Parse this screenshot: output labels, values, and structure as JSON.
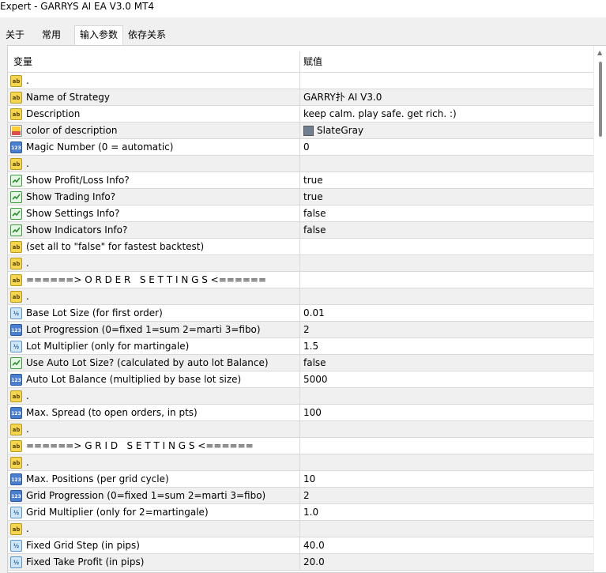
{
  "window": {
    "title": "Expert - GARRYS AI EA V3.0 MT4"
  },
  "tabs": [
    {
      "label": "关于"
    },
    {
      "label": "常用"
    },
    {
      "label": "输入参数"
    },
    {
      "label": "依存关系"
    }
  ],
  "table": {
    "headers": {
      "name": "变量",
      "value": "赋值"
    },
    "rows": [
      {
        "icon": "ab",
        "name": ".",
        "value": ""
      },
      {
        "icon": "ab",
        "name": "Name of Strategy",
        "value": "GARRY扑 AI V3.0"
      },
      {
        "icon": "ab",
        "name": "Description",
        "value": "keep calm. play safe. get rich. :)"
      },
      {
        "icon": "color",
        "name": "color of description",
        "value": "SlateGray",
        "swatch": "#708090"
      },
      {
        "icon": "123",
        "name": "Magic Number (0 = automatic)",
        "value": "0"
      },
      {
        "icon": "ab",
        "name": ".",
        "value": ""
      },
      {
        "icon": "bool",
        "name": "Show Profit/Loss Info?",
        "value": "true"
      },
      {
        "icon": "bool",
        "name": "Show Trading Info?",
        "value": "true"
      },
      {
        "icon": "bool",
        "name": "Show Settings Info?",
        "value": "false"
      },
      {
        "icon": "bool",
        "name": "Show Indicators Info?",
        "value": "false"
      },
      {
        "icon": "ab",
        "name": "(set all to \"false\" for fastest backtest)",
        "value": ""
      },
      {
        "icon": "ab",
        "name": ".",
        "value": ""
      },
      {
        "icon": "ab",
        "name": "======> O R D E R   S E T T I N G S <======",
        "value": ""
      },
      {
        "icon": "ab",
        "name": ".",
        "value": ""
      },
      {
        "icon": "half",
        "name": "Base Lot Size (for first order)",
        "value": "0.01"
      },
      {
        "icon": "123",
        "name": "Lot Progression (0=fixed 1=sum 2=marti 3=fibo)",
        "value": "2"
      },
      {
        "icon": "half",
        "name": "Lot Multiplier (only for martingale)",
        "value": "1.5"
      },
      {
        "icon": "bool",
        "name": "Use Auto Lot Size? (calculated by auto lot Balance)",
        "value": "false"
      },
      {
        "icon": "123",
        "name": "Auto Lot Balance (multiplied by base lot size)",
        "value": "5000"
      },
      {
        "icon": "ab",
        "name": ".",
        "value": ""
      },
      {
        "icon": "123",
        "name": "Max. Spread (to open orders, in pts)",
        "value": "100"
      },
      {
        "icon": "ab",
        "name": ".",
        "value": ""
      },
      {
        "icon": "ab",
        "name": "======> G R I D   S E T T I N G S <======",
        "value": ""
      },
      {
        "icon": "ab",
        "name": ".",
        "value": ""
      },
      {
        "icon": "123",
        "name": "Max. Positions (per grid cycle)",
        "value": "10"
      },
      {
        "icon": "123",
        "name": "Grid Progression (0=fixed 1=sum 2=marti 3=fibo)",
        "value": "2"
      },
      {
        "icon": "half",
        "name": "Grid Multiplier (only for 2=martingale)",
        "value": "1.0"
      },
      {
        "icon": "ab",
        "name": ".",
        "value": ""
      },
      {
        "icon": "half",
        "name": "Fixed Grid Step (in pips)",
        "value": "40.0"
      },
      {
        "icon": "half",
        "name": "Fixed Take Profit (in pips)",
        "value": "20.0"
      }
    ]
  }
}
